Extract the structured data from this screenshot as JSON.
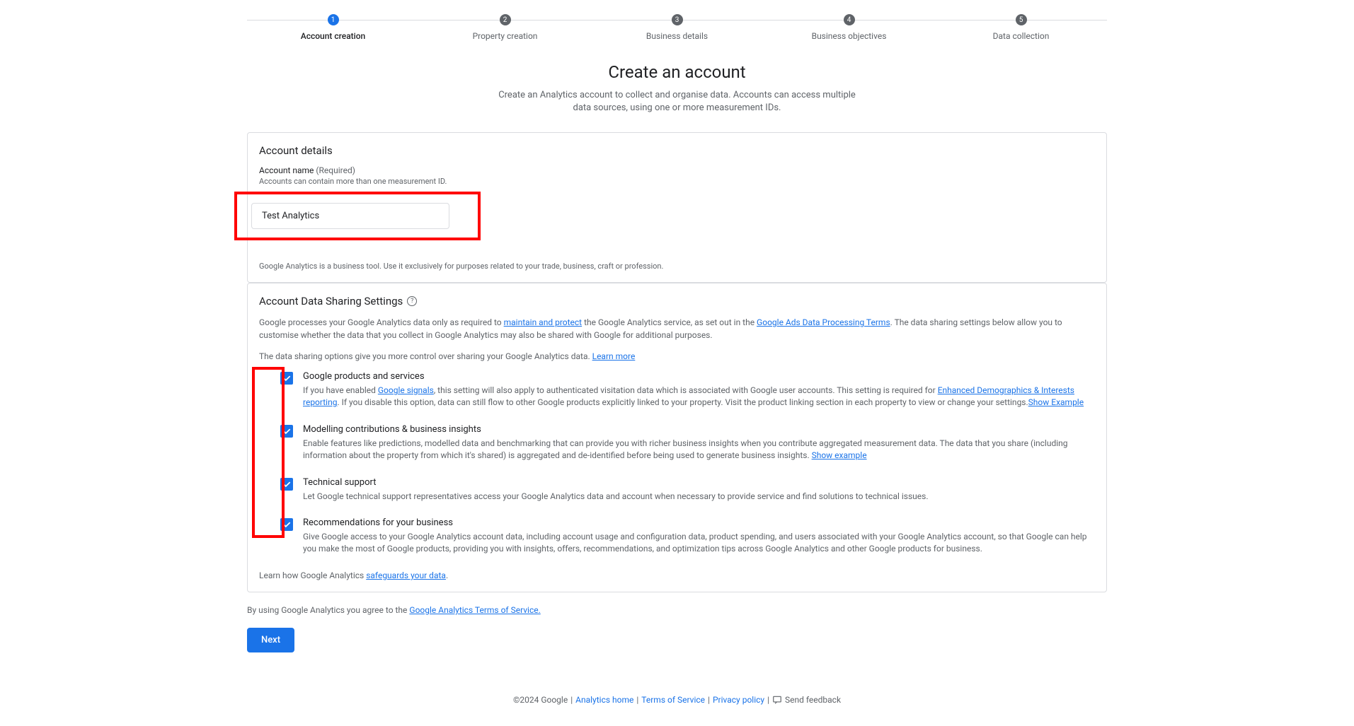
{
  "stepper": {
    "steps": [
      {
        "num": "1",
        "label": "Account creation",
        "active": true
      },
      {
        "num": "2",
        "label": "Property creation",
        "active": false
      },
      {
        "num": "3",
        "label": "Business details",
        "active": false
      },
      {
        "num": "4",
        "label": "Business objectives",
        "active": false
      },
      {
        "num": "5",
        "label": "Data collection",
        "active": false
      }
    ]
  },
  "page": {
    "title": "Create an account",
    "subtitle": "Create an Analytics account to collect and organise data. Accounts can access multiple data sources, using one or more measurement IDs."
  },
  "accountDetails": {
    "heading": "Account details",
    "nameLabel": "Account name",
    "requiredLabel": "(Required)",
    "helper": "Accounts can contain more than one measurement ID.",
    "value": "Test Analytics",
    "toolNote": "Google Analytics is a business tool. Use it exclusively for purposes related to your trade, business, craft or profession."
  },
  "sharing": {
    "heading": "Account Data Sharing Settings",
    "desc1_a": "Google processes your Google Analytics data only as required to ",
    "link_maintain": "maintain and protect",
    "desc1_b": " the Google Analytics service, as set out in the ",
    "link_terms": "Google Ads Data Processing Terms",
    "desc1_c": ". The data sharing settings below allow you to customise whether the data that you collect in Google Analytics may also be shared with Google for additional purposes.",
    "desc2_a": "The data sharing options give you more control over sharing your Google Analytics data. ",
    "link_learnmore": "Learn more",
    "items": [
      {
        "title": "Google products and services",
        "desc_a": "If you have enabled ",
        "link1": "Google signals",
        "desc_b": ", this setting will also apply to authenticated visitation data which is associated with Google user accounts. This setting is required for ",
        "link2": "Enhanced Demographics & Interests reporting",
        "desc_c": ". If you disable this option, data can still flow to other Google products explicitly linked to your property. Visit the product linking section in each property to view or change your settings.",
        "link3": "Show Example"
      },
      {
        "title": "Modelling contributions & business insights",
        "desc_a": "Enable features like predictions, modelled data and benchmarking that can provide you with richer business insights when you contribute aggregated measurement data. The data that you share (including information about the property from which it's shared) is aggregated and de-identified before being used to generate business insights. ",
        "link1": "Show example"
      },
      {
        "title": "Technical support",
        "desc_a": "Let Google technical support representatives access your Google Analytics data and account when necessary to provide service and find solutions to technical issues."
      },
      {
        "title": "Recommendations for your business",
        "desc_a": "Give Google access to your Google Analytics account data, including account usage and configuration data, product spending, and users associated with your Google Analytics account, so that Google can help you make the most of Google products, providing you with insights, offers, recommendations, and optimization tips across Google Analytics and other Google products for business."
      }
    ],
    "safeguards_a": "Learn how Google Analytics ",
    "safeguards_link": "safeguards your data",
    "safeguards_b": "."
  },
  "termsLine": {
    "a": "By using Google Analytics you agree to the ",
    "link": "Google Analytics Terms of Service."
  },
  "buttons": {
    "next": "Next"
  },
  "footer": {
    "copyright": "©2024 Google",
    "analyticsHome": "Analytics home",
    "tos": "Terms of Service",
    "privacy": "Privacy policy",
    "feedback": "Send feedback"
  }
}
